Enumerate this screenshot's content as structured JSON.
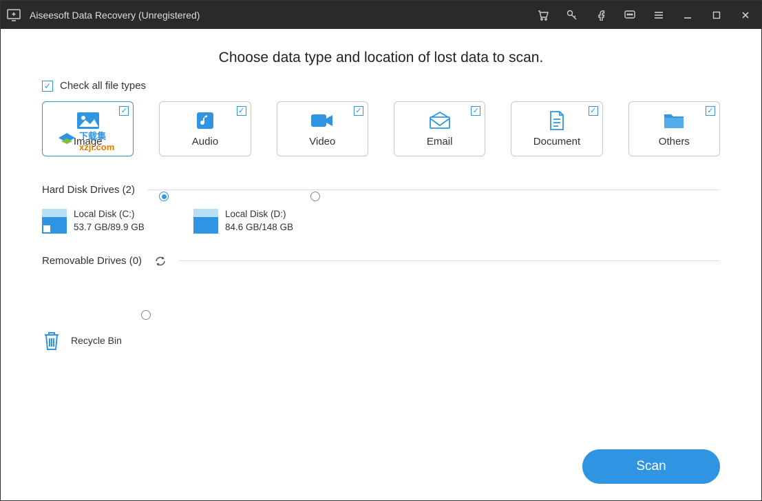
{
  "titlebar": {
    "title": "Aiseesoft Data Recovery (Unregistered)"
  },
  "headline": "Choose data type and location of lost data to scan.",
  "check_all_label": "Check all file types",
  "types": {
    "image": "Image",
    "audio": "Audio",
    "video": "Video",
    "email": "Email",
    "document": "Document",
    "others": "Others"
  },
  "sections": {
    "hdd": "Hard Disk Drives (2)",
    "removable": "Removable Drives (0)"
  },
  "drives": {
    "c": {
      "name": "Local Disk (C:)",
      "size": "53.7 GB/89.9 GB"
    },
    "d": {
      "name": "Local Disk (D:)",
      "size": "84.6 GB/148 GB"
    }
  },
  "recycle_label": "Recycle Bin",
  "scan_label": "Scan",
  "watermark": {
    "line1": "下载集",
    "line2": "xzji.com"
  }
}
